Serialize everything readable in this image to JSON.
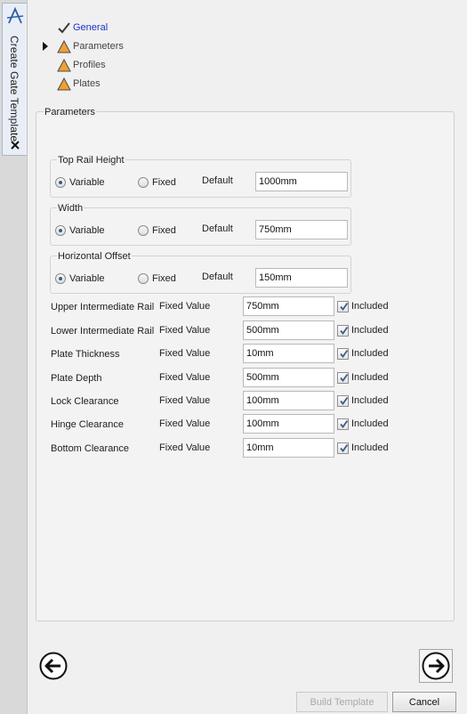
{
  "sidebar": {
    "title": "Create Gate Template"
  },
  "steps": [
    {
      "label": "General",
      "state": "completed",
      "active": true
    },
    {
      "label": "Parameters",
      "state": "warning",
      "current": true
    },
    {
      "label": "Profiles",
      "state": "warning"
    },
    {
      "label": "Plates",
      "state": "warning"
    }
  ],
  "parameters": {
    "group_label": "Parameters",
    "groups": [
      {
        "label": "Top Rail Height",
        "variable_label": "Variable",
        "fixed_label": "Fixed",
        "selected": "Variable",
        "default_label": "Default",
        "value": "1000mm"
      },
      {
        "label": "Width",
        "variable_label": "Variable",
        "fixed_label": "Fixed",
        "selected": "Variable",
        "default_label": "Default",
        "value": "750mm"
      },
      {
        "label": "Horizontal Offset",
        "variable_label": "Variable",
        "fixed_label": "Fixed",
        "selected": "Variable",
        "default_label": "Default",
        "value": "150mm"
      }
    ],
    "rows": [
      {
        "name": "Upper Intermediate Rail",
        "type": "Fixed Value",
        "value": "750mm",
        "included": true,
        "included_label": "Included"
      },
      {
        "name": "Lower Intermediate Rail",
        "type": "Fixed Value",
        "value": "500mm",
        "included": true,
        "included_label": "Included"
      },
      {
        "name": "Plate Thickness",
        "type": "Fixed Value",
        "value": "10mm",
        "included": true,
        "included_label": "Included"
      },
      {
        "name": "Plate Depth",
        "type": "Fixed Value",
        "value": "500mm",
        "included": true,
        "included_label": "Included"
      },
      {
        "name": "Lock Clearance",
        "type": "Fixed Value",
        "value": "100mm",
        "included": true,
        "included_label": "Included"
      },
      {
        "name": "Hinge Clearance",
        "type": "Fixed Value",
        "value": "100mm",
        "included": true,
        "included_label": "Included"
      },
      {
        "name": "Bottom Clearance",
        "type": "Fixed Value",
        "value": "10mm",
        "included": true,
        "included_label": "Included"
      }
    ]
  },
  "footer": {
    "build_label": "Build Template",
    "build_enabled": false,
    "cancel_label": "Cancel"
  },
  "icons": {
    "logo": "app-logo-icon",
    "close": "close-icon",
    "back": "back-arrow-icon",
    "next": "next-arrow-icon",
    "warning": "warning-icon",
    "check": "checkmark-icon",
    "current": "current-step-pointer-icon"
  },
  "colors": {
    "active_step": "#1a33c9",
    "warning": "#f0a030",
    "accent": "#3c5b8a"
  }
}
